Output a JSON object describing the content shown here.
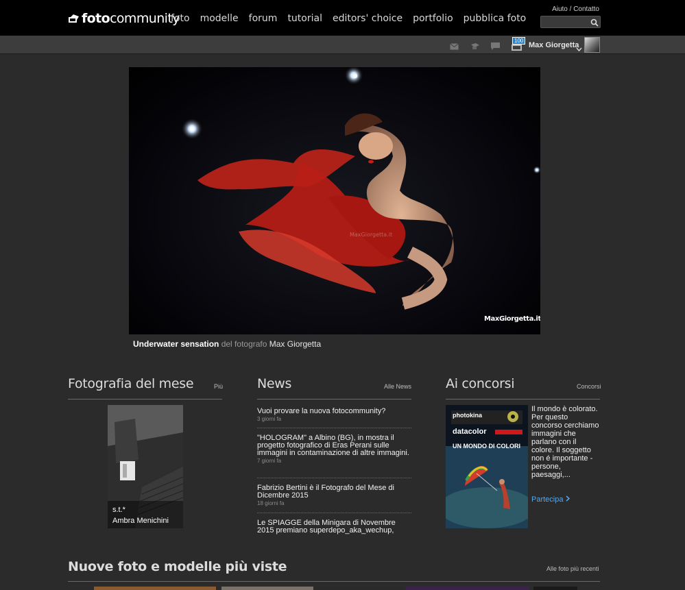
{
  "header": {
    "logo_bold": "foto",
    "logo_rest": "community",
    "nav": [
      "foto",
      "modelle",
      "forum",
      "tutorial",
      "editors' choice",
      "portfolio",
      "pubblica foto"
    ],
    "toplinks": "Aiuto / Contatto",
    "search": {
      "value": "",
      "placeholder": ""
    }
  },
  "userbar": {
    "badge": "100",
    "username": "Max Giorgetta",
    "icons": [
      "mail-icon",
      "flag-icon",
      "comment-icon",
      "notification-icon",
      "chevron-down-icon"
    ]
  },
  "hero": {
    "title": "Underwater sensation",
    "connector": " del fotografo ",
    "author": "Max Giorgetta",
    "watermark": "MaxGiorgetta.it",
    "watermark_center": "MaxGiorgetta.it"
  },
  "photo_of_month": {
    "heading": "Fotografia del mese",
    "link": "Più",
    "title": "s.t.*",
    "author": "Ambra Menichini"
  },
  "news": {
    "heading": "News",
    "link": "Alle News",
    "items": [
      {
        "title": "Vuoi provare la nuova fotocommunity?",
        "date": "3 giorni fa"
      },
      {
        "title": "\"HOLOGRAM\" a Albino (BG), in mostra il progetto fotografico di Eras Perani sulle immagini in contaminazione di altre immagini.",
        "date": "7 giorni fa"
      },
      {
        "title": "Fabrizio Bertini è il Fotografo del Mese di Dicembre 2015",
        "date": "18 giorni fa"
      },
      {
        "title": "Le SPIAGGE della Minigara di Novembre 2015 premiano superdepo_aka_wechup,",
        "date": ""
      }
    ]
  },
  "contests": {
    "heading": "Ai concorsi",
    "link": "Concorsi",
    "description": "Il mondo è colorato. Per questo concorso cerchiamo immagini che parlano con il colore. Il soggetto non é importante - persone, paesaggi,...",
    "cta": "Partecipa",
    "poster_brand1": "photokina",
    "poster_brand2": "datacolor",
    "poster_tagline": "UN MONDO DI COLORI"
  },
  "bottom": {
    "heading": "Nuove foto e modelle più viste",
    "link": "Alle foto più recenti"
  },
  "colors": {
    "accent_link": "#5aa7e8",
    "background": "#2b2b2b",
    "topbar": "#000000",
    "badge": "#2d7fc4"
  }
}
